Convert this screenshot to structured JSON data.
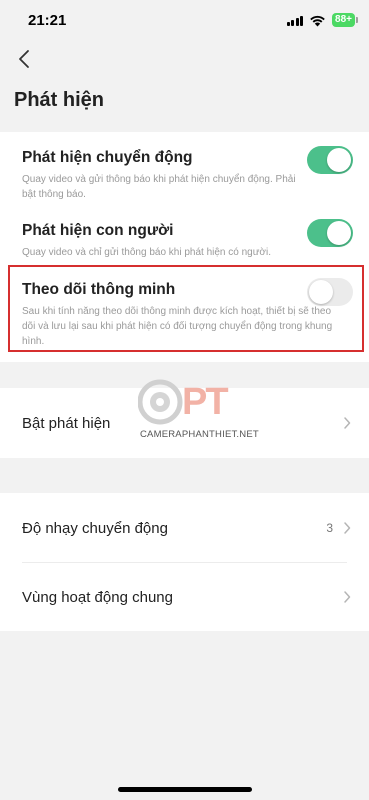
{
  "status_bar": {
    "time": "21:21",
    "battery": "88+",
    "icons": [
      "signal-icon",
      "wifi-icon",
      "battery-icon"
    ]
  },
  "header": {
    "back_icon": "chevron-left-icon",
    "title": "Phát hiện"
  },
  "detection": {
    "items": [
      {
        "title": "Phát hiện chuyển động",
        "description": "Quay video và gửi thông báo khi phát hiện chuyển động. Phải bật thông báo.",
        "enabled": true
      },
      {
        "title": "Phát hiện con người",
        "description": "Quay video và chỉ gửi thông báo khi phát hiện có người.",
        "enabled": true
      },
      {
        "title": "Theo dõi thông minh",
        "description": "Sau khi tính năng theo dõi thông minh được kích hoạt, thiết bị sẽ theo dõi và lưu lại sau khi phát hiện có đối tượng chuyển động trong khung hình.",
        "enabled": false,
        "highlighted": true
      }
    ]
  },
  "settings": {
    "enable_detection_label": "Bật phát hiện",
    "sensitivity_label": "Độ nhạy chuyển động",
    "sensitivity_value": "3",
    "activity_zone_label": "Vùng hoạt động chung"
  },
  "watermark": {
    "logo_text": "PT",
    "caption": "CAMERAPHANTHIET.NET"
  },
  "colors": {
    "toggle_on": "#4cc08b",
    "toggle_off": "#ebebeb",
    "highlight": "#d62f2f",
    "battery": "#4cd964",
    "background": "#f2f2f2"
  }
}
